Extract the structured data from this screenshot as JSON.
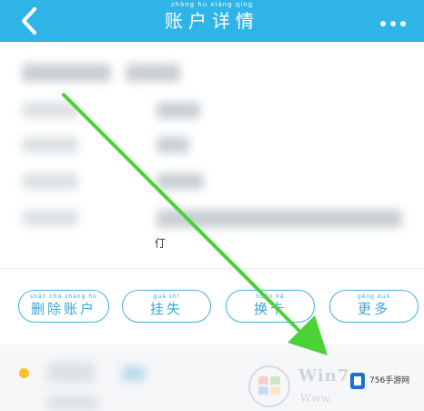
{
  "header": {
    "title": "账户详情",
    "title_pinyin": "zhàng hù xiáng qíng",
    "bg_color": "#2fb4e8"
  },
  "detail": {
    "stray_text": "仃"
  },
  "actions": [
    {
      "label": "删除账户",
      "pinyin": "shān chú zhàng hù"
    },
    {
      "label": "挂失",
      "pinyin": "guà shī"
    },
    {
      "label": "换卡",
      "pinyin": "huàn kǎ"
    },
    {
      "label": "更多",
      "pinyin": "gèng duō"
    }
  ],
  "watermark": {
    "win_text": "Win7",
    "win_sub": "Www.",
    "site_logo": "756手游网"
  },
  "colors": {
    "accent": "#47b0df",
    "annotation_arrow": "#4cd137",
    "status_dot": "#f5c12e"
  }
}
